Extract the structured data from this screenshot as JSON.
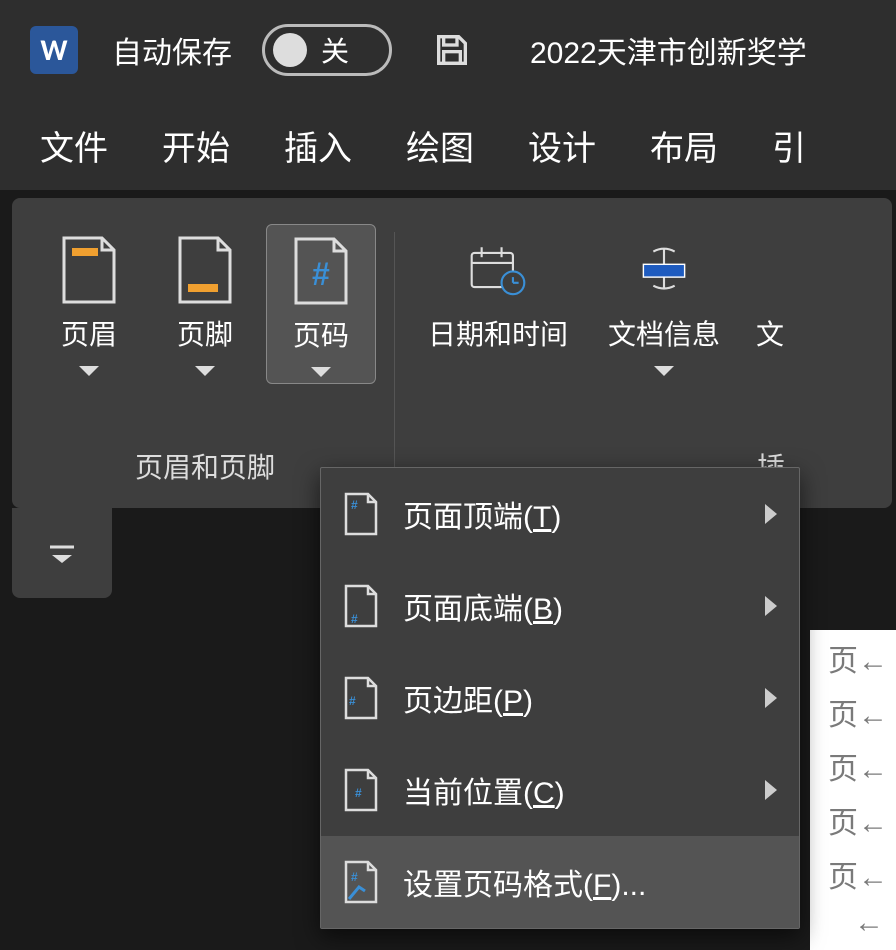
{
  "titlebar": {
    "app_letter": "W",
    "autosave_label": "自动保存",
    "toggle_state": "关",
    "doc_title": "2022天津市创新奖学"
  },
  "tabs": [
    "文件",
    "开始",
    "插入",
    "绘图",
    "设计",
    "布局",
    "引"
  ],
  "ribbon": {
    "group1_label": "页眉和页脚",
    "group2_label": "插",
    "buttons": {
      "header": "页眉",
      "footer": "页脚",
      "page_number": "页码",
      "date_time": "日期和时间",
      "doc_info": "文档信息",
      "doc_part": "文"
    }
  },
  "dropdown": {
    "items": [
      {
        "label": "页面顶端(T)",
        "hotkey": "T",
        "submenu": true
      },
      {
        "label": "页面底端(B)",
        "hotkey": "B",
        "submenu": true
      },
      {
        "label": "页边距(P)",
        "hotkey": "P",
        "submenu": true
      },
      {
        "label": "当前位置(C)",
        "hotkey": "C",
        "submenu": true
      },
      {
        "label": "设置页码格式(F)...",
        "hotkey": "F",
        "submenu": false
      }
    ]
  },
  "docbg": {
    "fragments": [
      "页←",
      "页←",
      "页←",
      "页←",
      "页←",
      "←"
    ]
  }
}
